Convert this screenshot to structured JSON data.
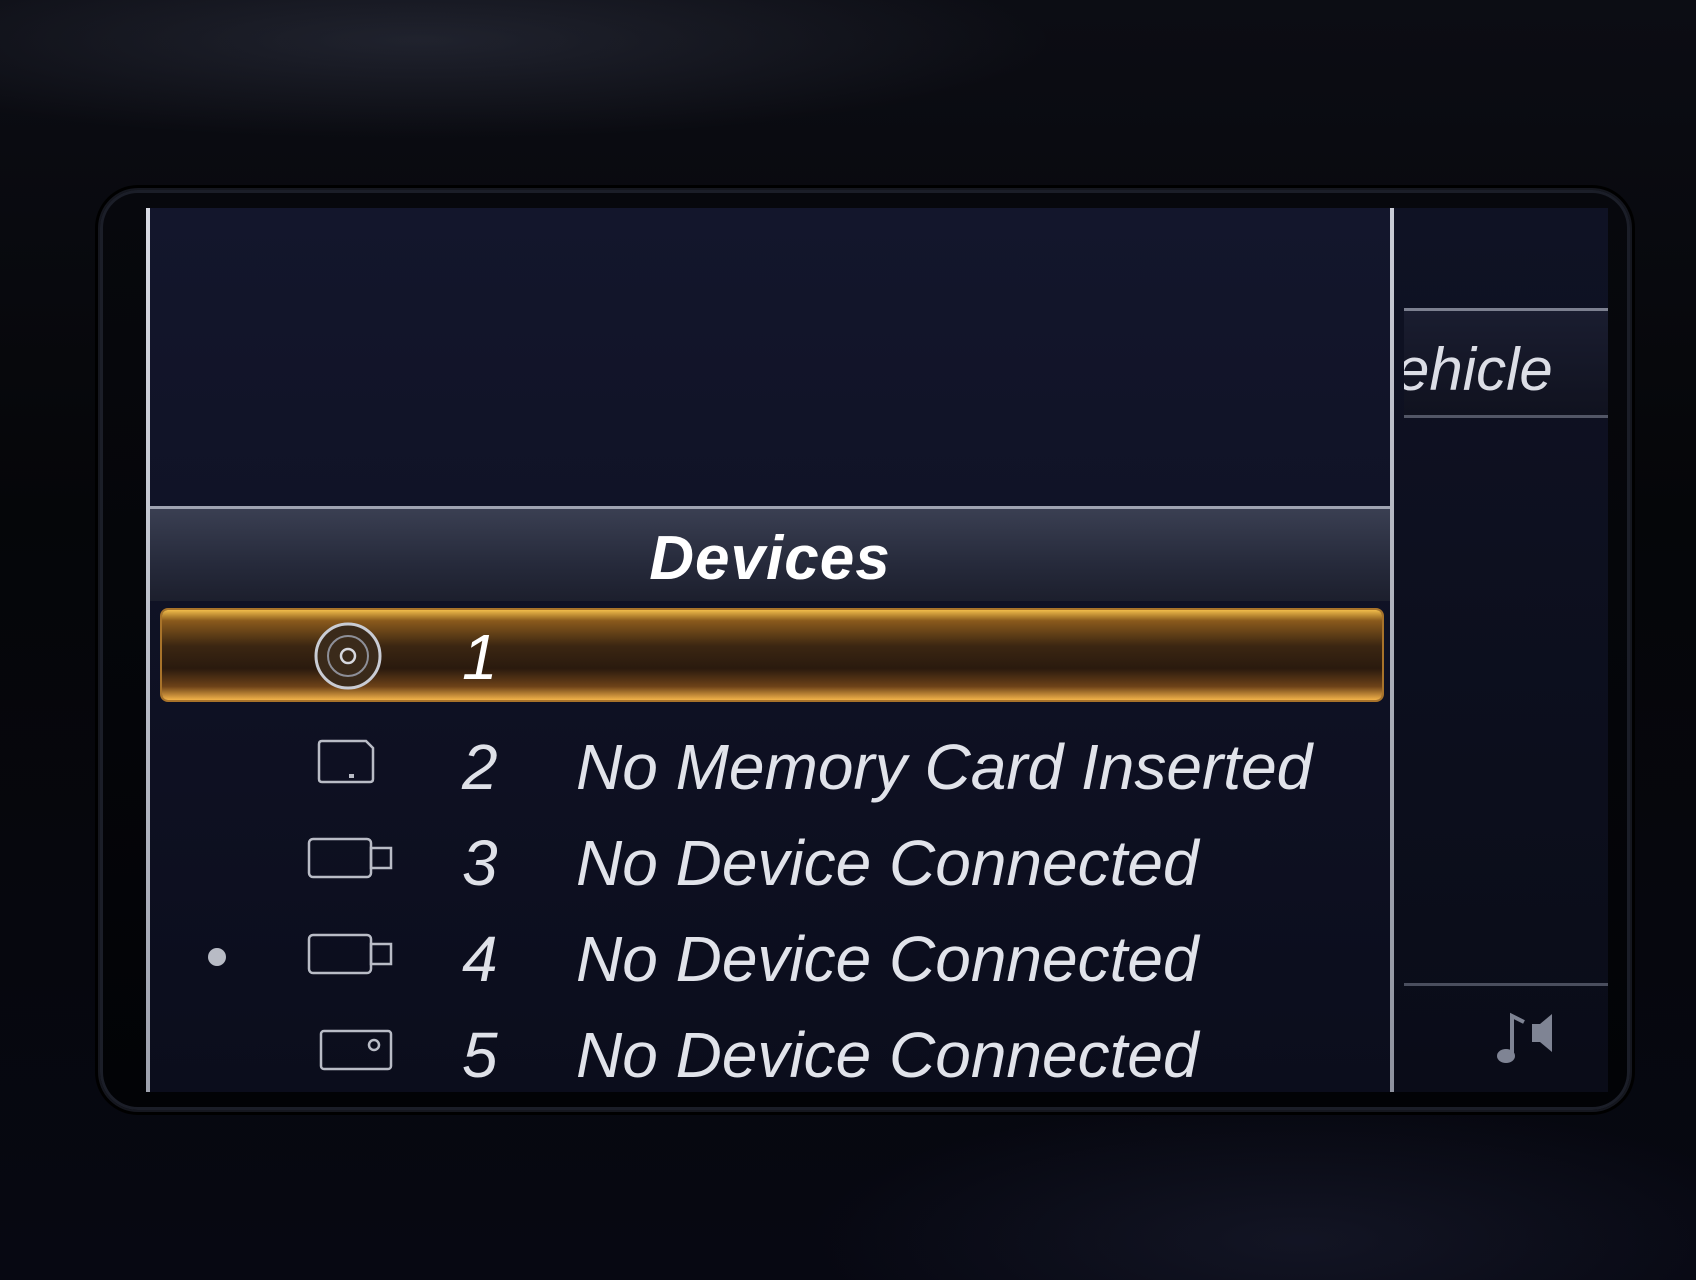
{
  "side_menu": {
    "top_item_label": "ehicle",
    "bottom_item_icon": "music-note-speaker-icon"
  },
  "devices": {
    "title": "Devices",
    "items": [
      {
        "number": "1",
        "label": "",
        "icon": "disc-icon",
        "selected": true
      },
      {
        "number": "2",
        "label": "No Memory Card Inserted",
        "icon": "memory-card-icon",
        "selected": false
      },
      {
        "number": "3",
        "label": "No Device Connected",
        "icon": "usb-stick-icon",
        "selected": false
      },
      {
        "number": "4",
        "label": "No Device Connected",
        "icon": "usb-stick-icon",
        "selected": false,
        "active_indicator": true
      },
      {
        "number": "5",
        "label": "No Device Connected",
        "icon": "media-device-icon",
        "selected": false
      }
    ]
  },
  "colors": {
    "highlight": "#e8a63c",
    "background": "#0c0e1c",
    "text": "#e1e3ea"
  }
}
